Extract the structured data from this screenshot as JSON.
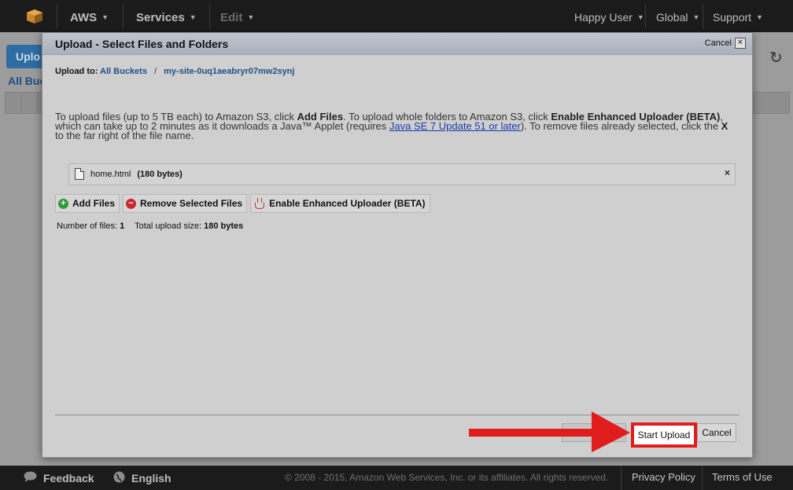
{
  "topnav": {
    "brand": "AWS",
    "services": "Services",
    "edit": "Edit",
    "user": "Happy User",
    "region": "Global",
    "support": "Support"
  },
  "background": {
    "upload_button": "Uplo",
    "all_buckets": "All Buck"
  },
  "modal": {
    "title": "Upload - Select Files and Folders",
    "cancel_top": "Cancel",
    "upload_to_label": "Upload to:",
    "crumb_all_buckets": "All Buckets",
    "crumb_separator": "/",
    "crumb_bucket": "my-site-0uq1aeabryr07mw2synj",
    "description": {
      "part1": "To upload files (up to 5 TB each) to Amazon S3, click ",
      "add_files_bold": "Add Files",
      "part2": ". To upload whole folders to Amazon S3, click ",
      "enhanced_bold": "Enable Enhanced Uploader (BETA)",
      "part3": ", which can take up to 2 minutes as it downloads a Java™ Applet (requires ",
      "java_link": "Java SE 7 Update 51 or later",
      "part4": "). To remove files already selected, click the ",
      "x_bold": "X",
      "part5": " to the far right of the file name."
    },
    "files": [
      {
        "name": "home.html",
        "size": "(180 bytes)"
      }
    ],
    "buttons": {
      "add_files": "Add Files",
      "remove_selected": "Remove Selected Files",
      "enhanced_uploader": "Enable Enhanced Uploader (BETA)"
    },
    "stats": {
      "num_files_label": "Number of files:",
      "num_files_value": "1",
      "total_size_label": "Total upload size:",
      "total_size_value": "180 bytes"
    },
    "start_upload": "Start Upload",
    "cancel": "Cancel"
  },
  "footer": {
    "feedback": "Feedback",
    "language": "English",
    "copyright": "© 2008 - 2015, Amazon Web Services, Inc. or its affiliates. All rights reserved.",
    "privacy": "Privacy Policy",
    "terms": "Terms of Use"
  },
  "colors": {
    "highlight_red": "#e01c1c",
    "link_blue": "#21508a",
    "nav_bg": "#1b1b1b"
  }
}
